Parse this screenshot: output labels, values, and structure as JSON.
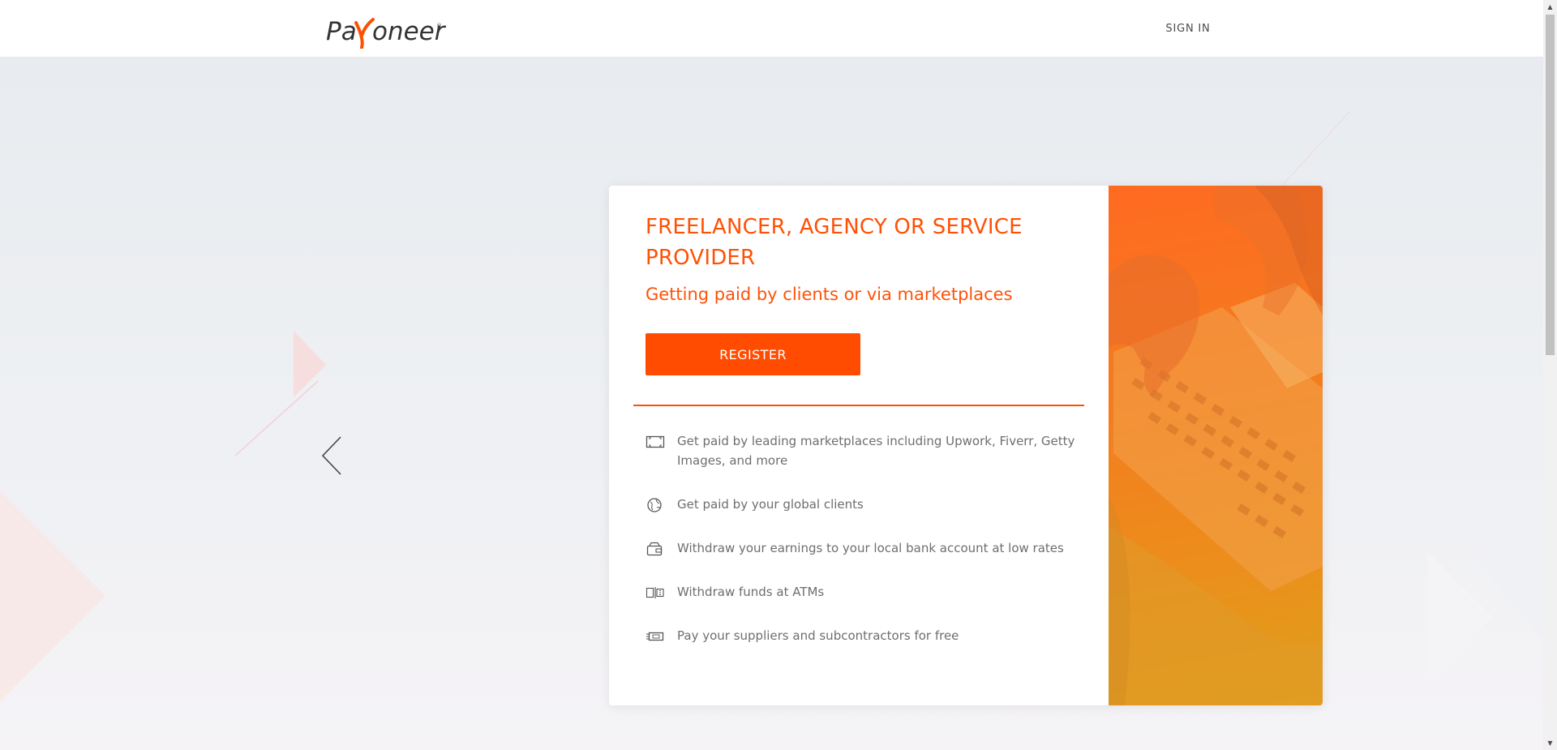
{
  "header": {
    "logo_text_left": "Pa",
    "logo_text_right": "oneer",
    "logo_mark": "®",
    "signin_label": "SIGN IN"
  },
  "card": {
    "title": "FREELANCER, AGENCY OR SERVICE PROVIDER",
    "subtitle": "Getting paid by clients or via marketplaces",
    "register_label": "REGISTER",
    "features": [
      {
        "icon": "marketplace-icon",
        "text": "Get paid by leading marketplaces including Upwork, Fiverr, Getty Images, and more"
      },
      {
        "icon": "globe-icon",
        "text": "Get paid by your global clients"
      },
      {
        "icon": "wallet-icon",
        "text": "Withdraw your earnings to your local bank account at low rates"
      },
      {
        "icon": "atm-icon",
        "text": "Withdraw funds at ATMs"
      },
      {
        "icon": "money-icon",
        "text": "Pay your suppliers and subcontractors for free"
      }
    ]
  },
  "colors": {
    "brand_orange": "#ff5106",
    "button_orange": "#ff4c00",
    "text_gray": "#6e6e6e",
    "header_text": "#4a4a4a"
  },
  "icons": {
    "carousel_prev": "chevron-left-icon"
  }
}
